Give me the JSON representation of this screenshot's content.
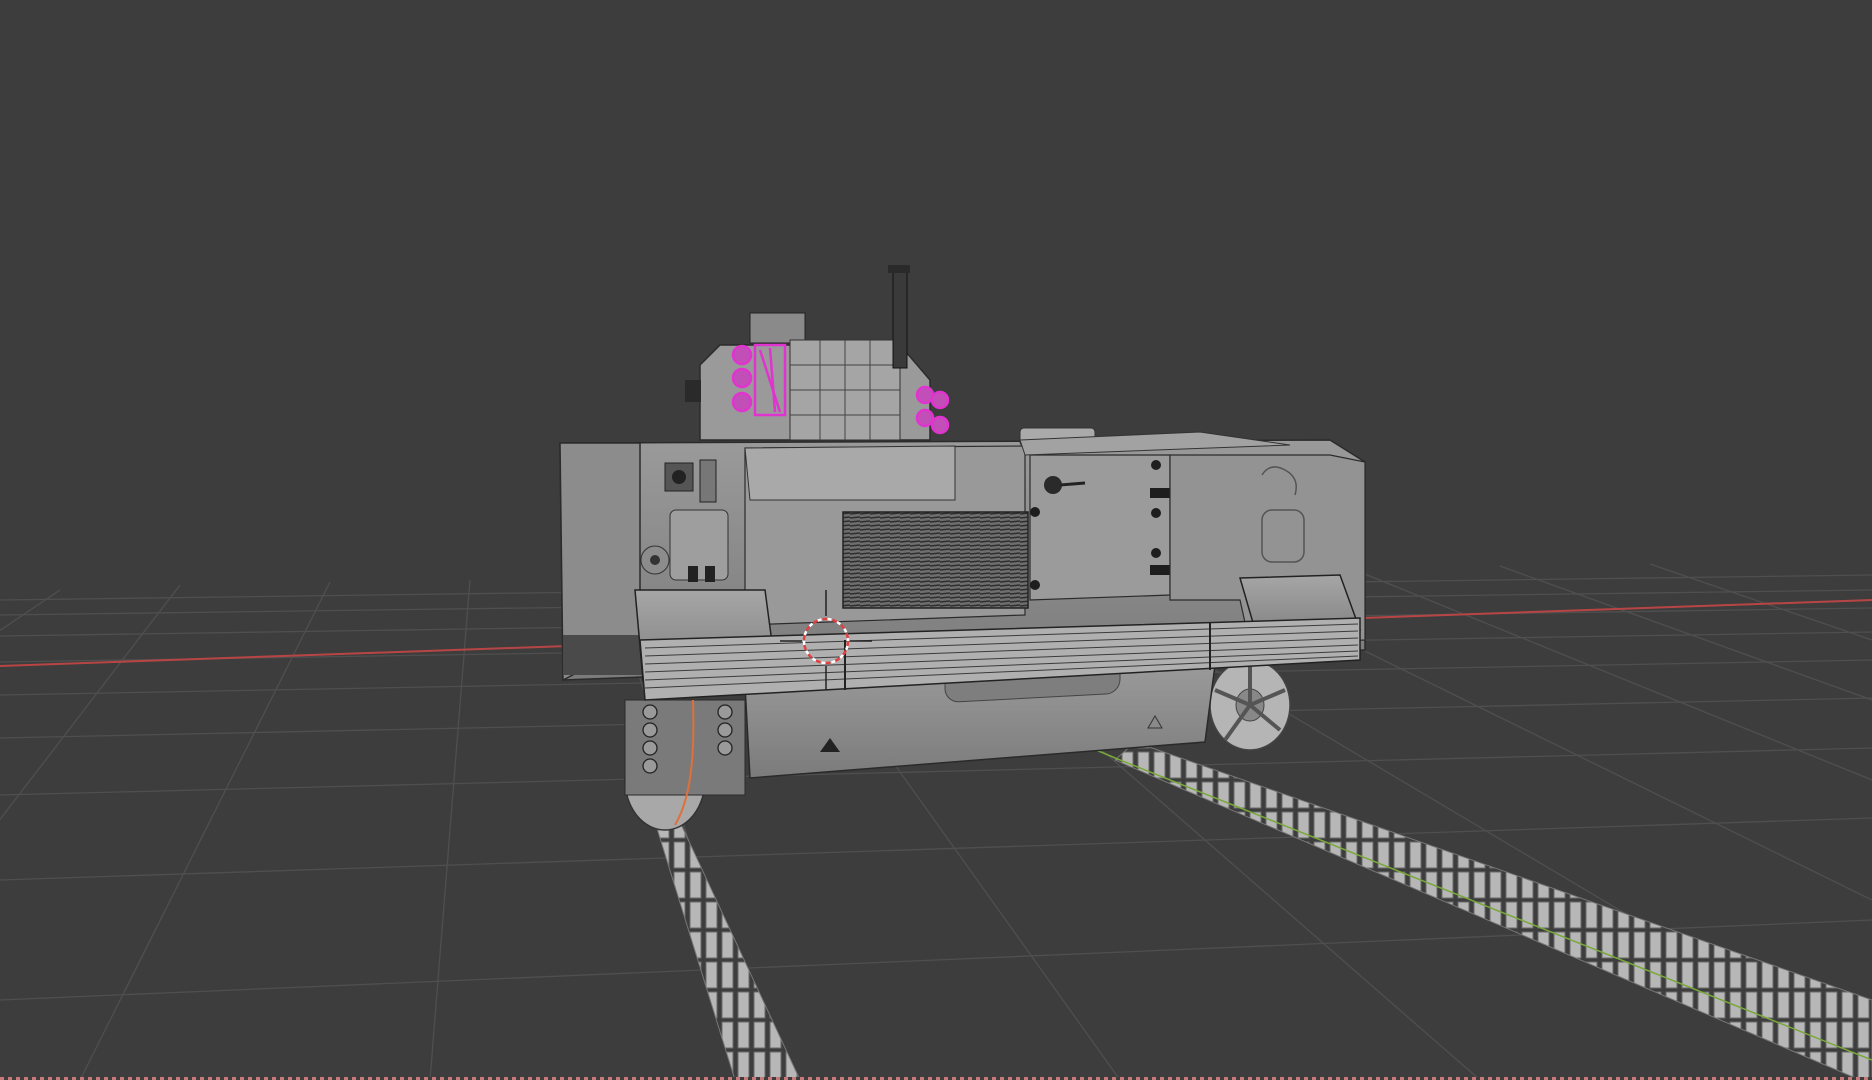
{
  "viewport": {
    "background": "#3d3d3d",
    "grid_color": "#4f4f4f",
    "x_axis_color": "#b84545",
    "y_axis_color": "#7aa83a",
    "selection_color": "#e033d0",
    "object_color": "#8a8a8a",
    "cursor_icon": "3d-cursor-icon"
  }
}
